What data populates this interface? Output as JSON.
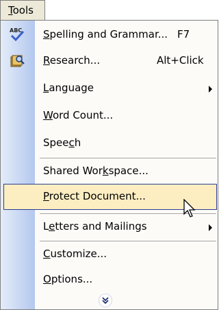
{
  "menu_title": "Tools",
  "menu_title_key": "T",
  "menu_title_rest": "ools",
  "items": [
    {
      "pre": "",
      "key": "S",
      "post": "pelling and Grammar...",
      "shortcut": "F7",
      "icon": "spelling-abc-icon"
    },
    {
      "pre": "",
      "key": "R",
      "post": "esearch...",
      "shortcut": "Alt+Click",
      "icon": "research-book-icon"
    },
    {
      "pre": "",
      "key": "L",
      "post": "anguage",
      "submenu": true
    },
    {
      "pre": "",
      "key": "W",
      "post": "ord Count..."
    },
    {
      "pre": "Spee",
      "key": "c",
      "post": "h"
    },
    {
      "pre": "Shared Wor",
      "key": "k",
      "post": "space..."
    },
    {
      "pre": "",
      "key": "P",
      "post": "rotect Document...",
      "highlighted": true
    },
    {
      "pre": "L",
      "key": "e",
      "post": "tters and Mailings",
      "submenu": true
    },
    {
      "pre": "",
      "key": "C",
      "post": "ustomize..."
    },
    {
      "pre": "",
      "key": "O",
      "post": "ptions..."
    }
  ],
  "expand_icon": "chevron-double-down-icon"
}
